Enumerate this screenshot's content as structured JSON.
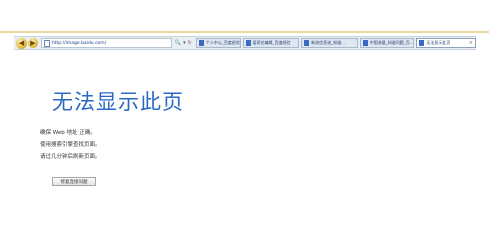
{
  "browser": {
    "address_url": "http://image.baidu.com/",
    "search_icon": "🔍",
    "dropdown_icon": "▾",
    "refresh_icon": "↻",
    "tabs": [
      {
        "label": "个人中心_百度经验"
      },
      {
        "label": "爱奇艺编辑_百度经验"
      },
      {
        "label": "新浪信息流_知道...",
        "active": false
      },
      {
        "label": "中国流量_知道问题_百..."
      },
      {
        "label": "无法显示此页",
        "active": true
      }
    ],
    "tab_close": "×"
  },
  "error_page": {
    "title": "无法显示此页",
    "tips": [
      "确保 Web 地址 正确。",
      "使用搜索引擎查找页面。",
      "请过几分钟后刷新页面。"
    ],
    "diagnose_button": "修复连接问题"
  }
}
